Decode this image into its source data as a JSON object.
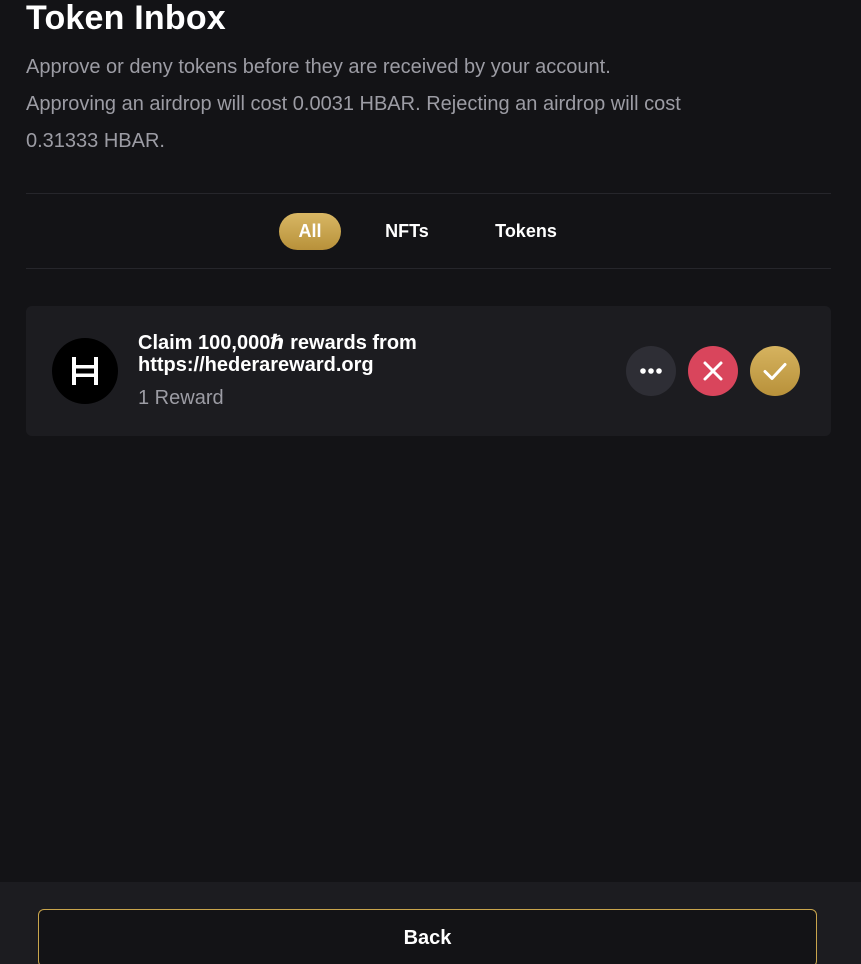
{
  "header": {
    "title": "Token Inbox",
    "description_line1": "Approve or deny tokens before they are received by your account.",
    "description_line2": "Approving an airdrop will cost 0.0031 HBAR. Rejecting an airdrop will cost",
    "description_line3": "0.31333 HBAR."
  },
  "tabs": [
    {
      "label": "All",
      "active": true
    },
    {
      "label": "NFTs",
      "active": false
    },
    {
      "label": "Tokens",
      "active": false
    }
  ],
  "items": [
    {
      "icon": "hedera-logo-icon",
      "title_line1": "Claim 100,000ℏ rewards from",
      "title_line2": "https://hederareward.org",
      "subtitle": "1 Reward"
    }
  ],
  "actions": {
    "more_icon": "more-horizontal-icon",
    "reject_icon": "close-icon",
    "approve_icon": "check-icon"
  },
  "footer": {
    "back_label": "Back"
  },
  "colors": {
    "background": "#131316",
    "card": "#1c1c20",
    "accent_gold": "#c9a54c",
    "reject_red": "#d9455c",
    "muted_text": "#9c9ca4"
  }
}
